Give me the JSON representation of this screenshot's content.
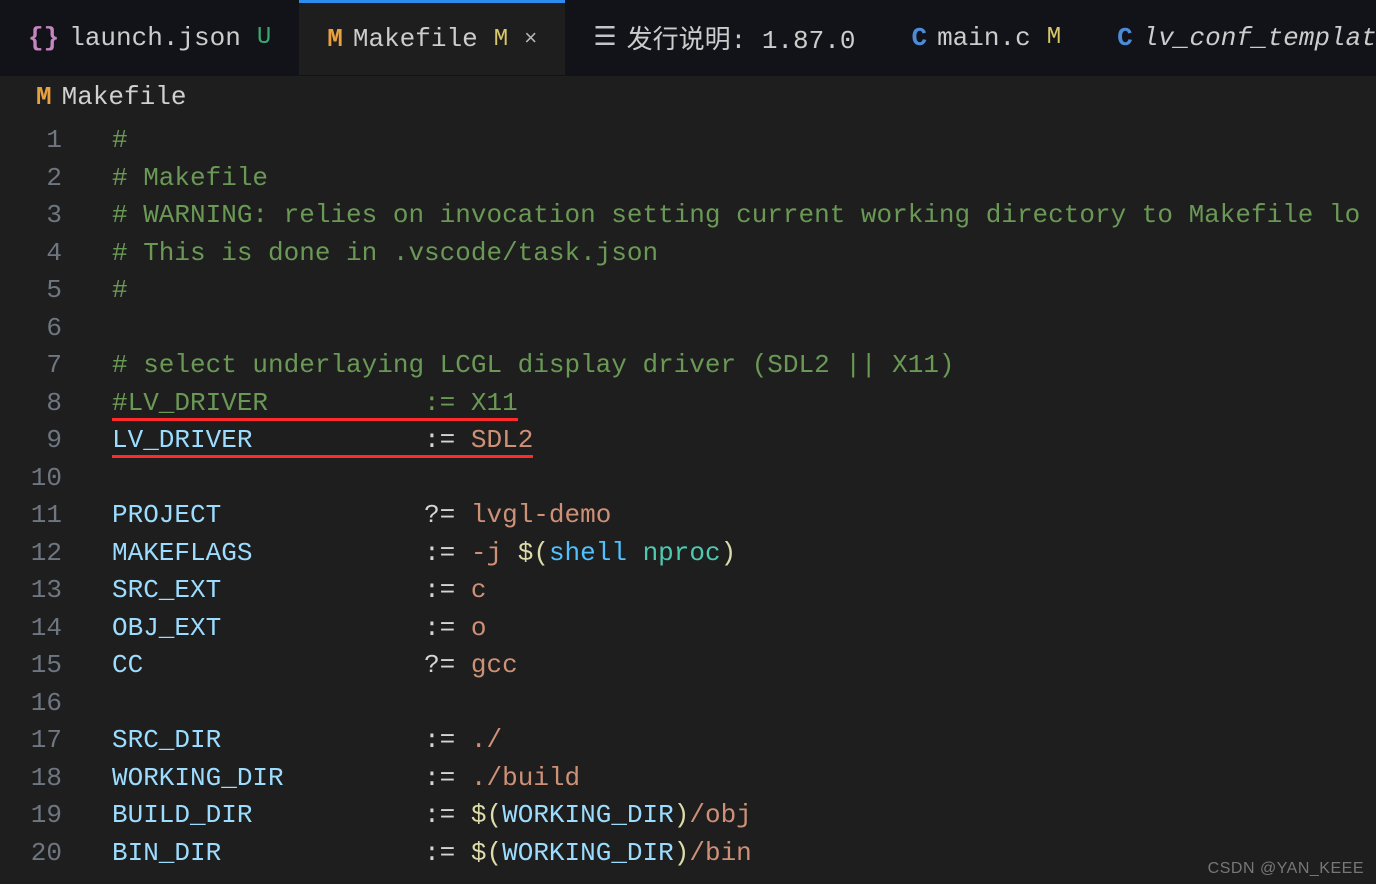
{
  "tabs": [
    {
      "icon": "braces",
      "label": "launch.json",
      "status": "U",
      "statusClass": "u",
      "active": false,
      "close": false,
      "italic": false
    },
    {
      "icon": "m",
      "label": "Makefile",
      "status": "M",
      "statusClass": "m",
      "active": true,
      "close": true,
      "italic": false
    },
    {
      "icon": "list",
      "label": "发行说明: 1.87.0",
      "status": "",
      "statusClass": "",
      "active": false,
      "close": false,
      "italic": false
    },
    {
      "icon": "c",
      "label": "main.c",
      "status": "M",
      "statusClass": "m",
      "active": false,
      "close": false,
      "italic": false
    },
    {
      "icon": "c",
      "label": "lv_conf_template.h",
      "status": "",
      "statusClass": "",
      "active": false,
      "close": false,
      "italic": true
    }
  ],
  "breadcrumb": {
    "icon": "m",
    "label": "Makefile"
  },
  "lines": [
    {
      "n": "1",
      "mod": false,
      "code": "<comment>#</comment>"
    },
    {
      "n": "2",
      "mod": false,
      "code": "<comment># Makefile</comment>"
    },
    {
      "n": "3",
      "mod": false,
      "code": "<comment># WARNING: relies on invocation setting current working directory to Makefile lo</comment>"
    },
    {
      "n": "4",
      "mod": false,
      "code": "<comment># This is done in .vscode/task.json</comment>"
    },
    {
      "n": "5",
      "mod": false,
      "code": "<comment>#</comment>"
    },
    {
      "n": "6",
      "mod": false,
      "code": ""
    },
    {
      "n": "7",
      "mod": false,
      "code": "<comment># select underlaying LCGL display driver (SDL2 || X11)</comment>"
    },
    {
      "n": "8",
      "mod": true,
      "code": "<comment><uline>#LV_DRIVER          := X11</uline></comment>"
    },
    {
      "n": "9",
      "mod": true,
      "code": "<uline><var>LV_DRIVER</var>           <assign>:=</assign> <val>SDL2</val></uline>"
    },
    {
      "n": "10",
      "mod": false,
      "code": ""
    },
    {
      "n": "11",
      "mod": false,
      "code": "<var>PROJECT</var>             <assign>?=</assign> <val>lvgl-demo</val>"
    },
    {
      "n": "12",
      "mod": false,
      "code": "<var>MAKEFLAGS</var>           <assign>:=</assign> <val>-j </val><paren>$(</paren><shell>shell</shell> <funccall>nproc</funccall><paren>)</paren>"
    },
    {
      "n": "13",
      "mod": false,
      "code": "<var>SRC_EXT</var>             <assign>:=</assign> <val>c</val>"
    },
    {
      "n": "14",
      "mod": false,
      "code": "<var>OBJ_EXT</var>             <assign>:=</assign> <val>o</val>"
    },
    {
      "n": "15",
      "mod": false,
      "code": "<var>CC</var>                  <assign>?=</assign> <val>gcc</val>"
    },
    {
      "n": "16",
      "mod": false,
      "code": ""
    },
    {
      "n": "17",
      "mod": false,
      "code": "<var>SRC_DIR</var>             <assign>:=</assign> <val>./</val>"
    },
    {
      "n": "18",
      "mod": false,
      "code": "<var>WORKING_DIR</var>         <assign>:=</assign> <val>./build</val>"
    },
    {
      "n": "19",
      "mod": false,
      "code": "<var>BUILD_DIR</var>           <assign>:=</assign> <paren>$(</paren><var>WORKING_DIR</var><paren>)</paren><val>/obj</val>"
    },
    {
      "n": "20",
      "mod": false,
      "code": "<bg></bg><var>BIN_DIR</var>             <assign>:=</assign> <paren>$(</paren><var>WORKING_DIR</var><paren>)</paren><val>/bin</val>"
    }
  ],
  "watermark": "CSDN @YAN_KEEE"
}
